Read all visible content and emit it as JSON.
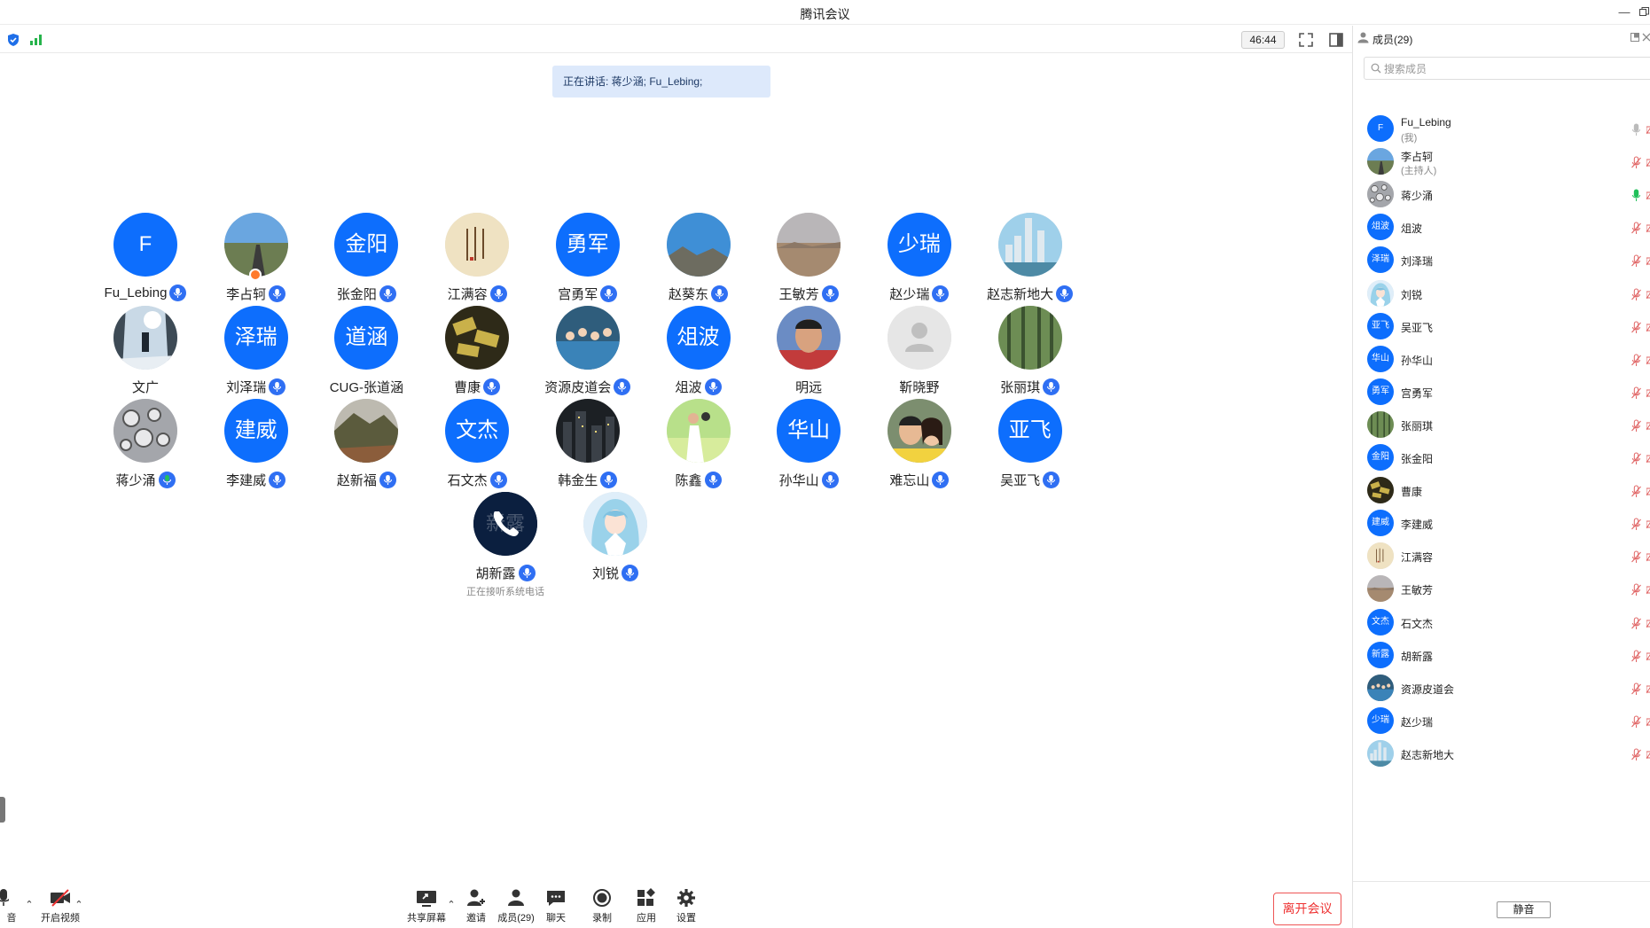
{
  "app": {
    "title": "腾讯会议"
  },
  "meeting": {
    "timer": "46:44",
    "speaking": "正在讲话: 蒋少涵; Fu_Lebing;"
  },
  "gallery": [
    {
      "name": "Fu_Lebing",
      "avatar_text": "F",
      "avatar": "initial"
    },
    {
      "name": "李占轲",
      "avatar": "photo-road",
      "host": true
    },
    {
      "name": "张金阳",
      "avatar_text": "金阳",
      "avatar": "initial"
    },
    {
      "name": "江满容",
      "avatar": "photo-calligraphy"
    },
    {
      "name": "宫勇军",
      "avatar_text": "勇军",
      "avatar": "initial"
    },
    {
      "name": "赵葵东",
      "avatar": "photo-mountain-sky"
    },
    {
      "name": "王敏芳",
      "avatar": "photo-desert"
    },
    {
      "name": "赵少瑞",
      "avatar_text": "少瑞",
      "avatar": "initial"
    },
    {
      "name": "赵志新地大",
      "avatar": "photo-city"
    },
    {
      "name": "文广",
      "avatar": "photo-snow",
      "muted_icon": false
    },
    {
      "name": "刘泽瑞",
      "avatar_text": "泽瑞",
      "avatar": "initial"
    },
    {
      "name": "CUG-张道涵",
      "avatar_text": "道涵",
      "avatar": "initial",
      "muted_icon": false
    },
    {
      "name": "曹康",
      "avatar": "photo-gold"
    },
    {
      "name": "资源皮道会",
      "avatar": "photo-group"
    },
    {
      "name": "俎波",
      "avatar_text": "俎波",
      "avatar": "initial"
    },
    {
      "name": "明远",
      "avatar": "photo-man",
      "muted_icon": false
    },
    {
      "name": "靳晓野",
      "avatar": "default",
      "muted_icon": false
    },
    {
      "name": "张丽琪",
      "avatar": "photo-forest"
    },
    {
      "name": "蒋少涌",
      "avatar": "photo-rocks",
      "speaking": true
    },
    {
      "name": "李建威",
      "avatar_text": "建威",
      "avatar": "initial"
    },
    {
      "name": "赵新福",
      "avatar": "photo-hill"
    },
    {
      "name": "石文杰",
      "avatar_text": "文杰",
      "avatar": "initial"
    },
    {
      "name": "韩金生",
      "avatar": "photo-night"
    },
    {
      "name": "陈鑫",
      "avatar": "photo-wedding"
    },
    {
      "name": "孙华山",
      "avatar_text": "华山",
      "avatar": "initial"
    },
    {
      "name": "难忘山",
      "avatar": "photo-couple"
    },
    {
      "name": "吴亚飞",
      "avatar_text": "亚飞",
      "avatar": "initial"
    },
    {
      "name": "胡新露",
      "avatar_text": "新露",
      "avatar": "phone",
      "sub": "正在接听系统电话"
    },
    {
      "name": "刘锐",
      "avatar": "photo-anime"
    }
  ],
  "toolbar": {
    "mic_label": "音",
    "video_label": "开启视频",
    "share_label": "共享屏幕",
    "invite_label": "邀请",
    "members_label": "成员(29)",
    "chat_label": "聊天",
    "record_label": "录制",
    "apps_label": "应用",
    "settings_label": "设置",
    "leave_label": "离开会议"
  },
  "members_panel": {
    "title": "成员(29)",
    "search_placeholder": "搜索成员",
    "mute_all_label": "静音",
    "members": [
      {
        "name": "Fu_Lebing",
        "role": "(我)",
        "avatar_text": "F",
        "avatar": "initial",
        "mic": "gray"
      },
      {
        "name": "李占轲",
        "role": "(主持人)",
        "avatar": "photo-road",
        "mic": "muted"
      },
      {
        "name": "蒋少涌",
        "avatar": "photo-rocks",
        "mic": "green"
      },
      {
        "name": "俎波",
        "avatar_text": "俎波",
        "avatar": "initial",
        "mic": "muted"
      },
      {
        "name": "刘泽瑞",
        "avatar_text": "泽瑞",
        "avatar": "initial",
        "mic": "muted"
      },
      {
        "name": "刘锐",
        "avatar": "photo-anime",
        "mic": "muted"
      },
      {
        "name": "吴亚飞",
        "avatar_text": "亚飞",
        "avatar": "initial",
        "mic": "muted"
      },
      {
        "name": "孙华山",
        "avatar_text": "华山",
        "avatar": "initial",
        "mic": "muted"
      },
      {
        "name": "宫勇军",
        "avatar_text": "勇军",
        "avatar": "initial",
        "mic": "muted"
      },
      {
        "name": "张丽琪",
        "avatar": "photo-forest",
        "mic": "muted"
      },
      {
        "name": "张金阳",
        "avatar_text": "金阳",
        "avatar": "initial",
        "mic": "muted"
      },
      {
        "name": "曹康",
        "avatar": "photo-gold",
        "mic": "muted"
      },
      {
        "name": "李建威",
        "avatar_text": "建威",
        "avatar": "initial",
        "mic": "muted"
      },
      {
        "name": "江满容",
        "avatar": "photo-calligraphy",
        "mic": "muted"
      },
      {
        "name": "王敏芳",
        "avatar": "photo-desert",
        "mic": "muted"
      },
      {
        "name": "石文杰",
        "avatar_text": "文杰",
        "avatar": "initial",
        "mic": "muted"
      },
      {
        "name": "胡新露",
        "avatar_text": "新露",
        "avatar": "initial",
        "mic": "muted"
      },
      {
        "name": "资源皮道会",
        "avatar": "photo-group",
        "mic": "muted"
      },
      {
        "name": "赵少瑞",
        "avatar_text": "少瑞",
        "avatar": "initial",
        "mic": "muted"
      },
      {
        "name": "赵志新地大",
        "avatar": "photo-city",
        "mic": "muted"
      }
    ]
  },
  "colors": {
    "brand_blue": "#0d6efd",
    "mic_blue": "#2f6ff3",
    "speaking_green": "#21c05a",
    "leave_red": "#e33333",
    "banner_bg": "#dde9fb"
  }
}
